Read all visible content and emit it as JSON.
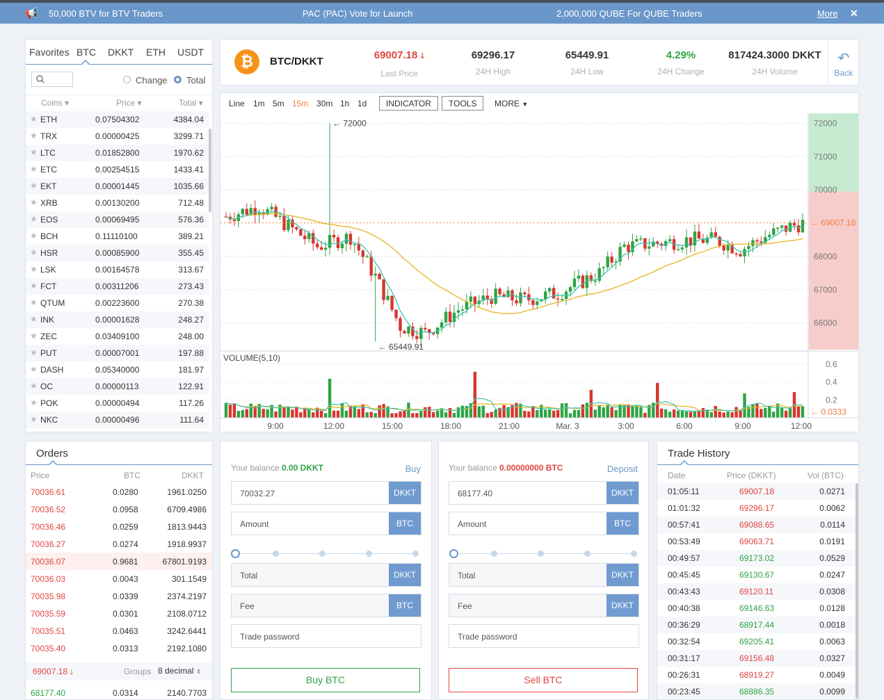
{
  "topbar": {
    "items": [
      "50,000 BTV for BTV Traders",
      "PAC (PAC) Vote for Launch",
      "2,000,000 QUBE For QUBE Traders"
    ],
    "more": "More",
    "close": "✕"
  },
  "market": {
    "tabs": [
      "Favorites",
      "BTC",
      "DKKT",
      "ETH",
      "USDT"
    ],
    "active_tab": "BTC",
    "search_placeholder": "",
    "radio_change": "Change",
    "radio_total": "Total",
    "col_coins": "Coins",
    "col_price": "Price",
    "col_total": "Total",
    "rows": [
      {
        "sym": "ETH",
        "price": "0.07504302",
        "total": "4384.04"
      },
      {
        "sym": "TRX",
        "price": "0.00000425",
        "total": "3299.71"
      },
      {
        "sym": "LTC",
        "price": "0.01852800",
        "total": "1970.62"
      },
      {
        "sym": "ETC",
        "price": "0.00254515",
        "total": "1433.41"
      },
      {
        "sym": "EKT",
        "price": "0.00001445",
        "total": "1035.66"
      },
      {
        "sym": "XRB",
        "price": "0.00130200",
        "total": "712.48"
      },
      {
        "sym": "EOS",
        "price": "0.00069495",
        "total": "576.36"
      },
      {
        "sym": "BCH",
        "price": "0.11110100",
        "total": "389.21"
      },
      {
        "sym": "HSR",
        "price": "0.00085900",
        "total": "355.45"
      },
      {
        "sym": "LSK",
        "price": "0.00164578",
        "total": "313.67"
      },
      {
        "sym": "FCT",
        "price": "0.00311206",
        "total": "273.43"
      },
      {
        "sym": "QTUM",
        "price": "0.00223600",
        "total": "270.38"
      },
      {
        "sym": "INK",
        "price": "0.00001628",
        "total": "248.27"
      },
      {
        "sym": "ZEC",
        "price": "0.03409100",
        "total": "248.00"
      },
      {
        "sym": "PUT",
        "price": "0.00007001",
        "total": "197.88"
      },
      {
        "sym": "DASH",
        "price": "0.05340000",
        "total": "181.97"
      },
      {
        "sym": "OC",
        "price": "0.00000113",
        "total": "122.91"
      },
      {
        "sym": "POK",
        "price": "0.00000494",
        "total": "117.26"
      },
      {
        "sym": "NKC",
        "price": "0.00000496",
        "total": "111.64"
      }
    ]
  },
  "ticker": {
    "pair": "BTC/DKKT",
    "last_price": "69007.18",
    "last_price_label": "Last Price",
    "high": "69296.17",
    "high_label": "24H High",
    "low": "65449.91",
    "low_label": "24H Low",
    "change": "4.29%",
    "change_label": "24H Change",
    "volume": "817424.3000 DKKT",
    "volume_label": "24H Volume",
    "back": "Back"
  },
  "toolbar": {
    "timeframes": [
      "Line",
      "1m",
      "5m",
      "15m",
      "30m",
      "1h",
      "1d"
    ],
    "active": "15m",
    "indicator": "INDICATOR",
    "tools": "TOOLS",
    "more": "MORE"
  },
  "chart_data": {
    "type": "candlestick",
    "price_ticks": [
      "72000",
      "71000",
      "70000",
      "68000",
      "67000",
      "66000"
    ],
    "current_price_label": "69007.18",
    "max_marker": "72000",
    "min_marker": "65449.91",
    "volume_label": "VOLUME(5,10)",
    "volume_ticks": [
      "0.6",
      "0.4",
      "0.2"
    ],
    "volume_current": "0.0333",
    "x_ticks": [
      "9:00",
      "12:00",
      "15:00",
      "18:00",
      "21:00",
      "Mar. 3",
      "3:00",
      "6:00",
      "9:00",
      "12:00"
    ],
    "ylim": [
      65200,
      72300
    ],
    "colors": {
      "up": "#2ea443",
      "down": "#d8352f",
      "ma_fast": "#3cc3b1",
      "ma_slow": "#e6b422"
    }
  },
  "orders": {
    "title": "Orders",
    "col_price": "Price",
    "col_btc": "BTC",
    "col_dkkt": "DKKT",
    "asks": [
      {
        "price": "70036.61",
        "btc": "0.0280",
        "dkkt": "1961.0250"
      },
      {
        "price": "70036.52",
        "btc": "0.0958",
        "dkkt": "6709.4986"
      },
      {
        "price": "70036.46",
        "btc": "0.0259",
        "dkkt": "1813.9443"
      },
      {
        "price": "70036.27",
        "btc": "0.0274",
        "dkkt": "1918.9937"
      },
      {
        "price": "70036.07",
        "btc": "0.9681",
        "dkkt": "67801.9193"
      },
      {
        "price": "70036.03",
        "btc": "0.0043",
        "dkkt": "301.1549"
      },
      {
        "price": "70035.98",
        "btc": "0.0339",
        "dkkt": "2374.2197"
      },
      {
        "price": "70035.59",
        "btc": "0.0301",
        "dkkt": "2108.0712"
      },
      {
        "price": "70035.51",
        "btc": "0.0463",
        "dkkt": "3242.6441"
      },
      {
        "price": "70035.40",
        "btc": "0.0313",
        "dkkt": "2192.1080"
      }
    ],
    "mid_price": "69007.18",
    "groups_label": "Groups",
    "groups_value": "8 decimal",
    "bid": {
      "price": "68177.40",
      "btc": "0.0314",
      "dkkt": "2140.7703"
    }
  },
  "buy": {
    "balance_label": "Your balance",
    "balance": "0.00 DKKT",
    "link": "Buy",
    "price": "70032.27",
    "price_unit": "DKKT",
    "amount_ph": "Amount",
    "amount_unit": "BTC",
    "total_ph": "Total",
    "total_unit": "DKKT",
    "fee_ph": "Fee",
    "fee_unit": "BTC",
    "password_ph": "Trade password",
    "button": "Buy BTC"
  },
  "sell": {
    "balance_label": "Your balance",
    "balance": "0.00000000 BTC",
    "link": "Deposit",
    "price": "68177.40",
    "price_unit": "DKKT",
    "amount_ph": "Amount",
    "amount_unit": "BTC",
    "total_ph": "Total",
    "total_unit": "DKKT",
    "fee_ph": "Fee",
    "fee_unit": "DKKT",
    "password_ph": "Trade password",
    "button": "Sell BTC"
  },
  "history": {
    "title": "Trade History",
    "col_date": "Date",
    "col_price": "Price (DKKT)",
    "col_vol": "Vol (BTC)",
    "rows": [
      {
        "date": "01:05:11",
        "price": "69007.18",
        "vol": "0.0271",
        "side": "sell"
      },
      {
        "date": "01:01:32",
        "price": "69296.17",
        "vol": "0.0062",
        "side": "sell"
      },
      {
        "date": "00:57:41",
        "price": "69088.65",
        "vol": "0.0114",
        "side": "sell"
      },
      {
        "date": "00:53:49",
        "price": "69063.71",
        "vol": "0.0191",
        "side": "sell"
      },
      {
        "date": "00:49:57",
        "price": "69173.02",
        "vol": "0.0529",
        "side": "buy"
      },
      {
        "date": "00:45:45",
        "price": "69130.67",
        "vol": "0.0247",
        "side": "buy"
      },
      {
        "date": "00:43:43",
        "price": "69120.11",
        "vol": "0.0308",
        "side": "sell"
      },
      {
        "date": "00:40:38",
        "price": "69146.63",
        "vol": "0.0128",
        "side": "buy"
      },
      {
        "date": "00:36:29",
        "price": "68917.44",
        "vol": "0.0018",
        "side": "buy"
      },
      {
        "date": "00:32:54",
        "price": "69205.41",
        "vol": "0.0063",
        "side": "buy"
      },
      {
        "date": "00:31:17",
        "price": "69156.48",
        "vol": "0.0327",
        "side": "sell"
      },
      {
        "date": "00:26:31",
        "price": "68919.27",
        "vol": "0.0049",
        "side": "sell"
      },
      {
        "date": "00:23:45",
        "price": "68886.35",
        "vol": "0.0099",
        "side": "buy"
      }
    ]
  }
}
